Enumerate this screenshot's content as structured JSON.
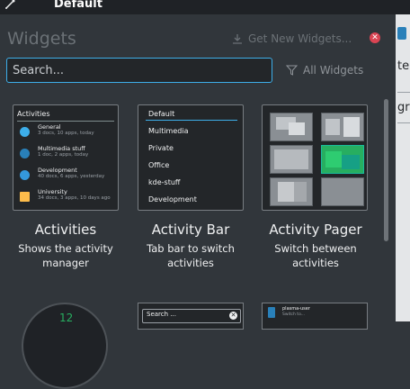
{
  "window": {
    "title": "Default"
  },
  "panel": {
    "title": "Widgets",
    "get_new_label": "Get New Widgets...",
    "search_placeholder": "Search...",
    "filter_label": "All Widgets"
  },
  "right_strip": {
    "text1": "te",
    "text2": "gr"
  },
  "widgets": [
    {
      "name": "Activities",
      "description": "Shows the activity manager",
      "preview": {
        "header": "Activities",
        "items": [
          {
            "name": "General",
            "desc": "3 docs, 10 apps, today",
            "color": "#3daee9"
          },
          {
            "name": "Multimedia stuff",
            "desc": "1 doc, 2 apps, today",
            "color": "#2980b9"
          },
          {
            "name": "Development",
            "desc": "40 docs, 6 apps, yesterday",
            "color": "#3498db"
          },
          {
            "name": "University",
            "desc": "34 docs, 3 apps, 10 days ago",
            "color": "#fdbc4b"
          }
        ]
      }
    },
    {
      "name": "Activity Bar",
      "description": "Tab bar to switch activities",
      "preview": {
        "items": [
          "Default",
          "Multimedia",
          "Private",
          "Office",
          "kde-stuff",
          "Development"
        ]
      }
    },
    {
      "name": "Activity Pager",
      "description": "Switch between activities",
      "preview": {
        "active_index": 3
      }
    }
  ],
  "bottom": {
    "clock_text": "12",
    "search_text": "Search ...",
    "notif_title": "plasma-user",
    "notif_sub": "Switch to..."
  },
  "colors": {
    "accent": "#3daee9",
    "close": "#da4453",
    "background": "#31363b"
  }
}
